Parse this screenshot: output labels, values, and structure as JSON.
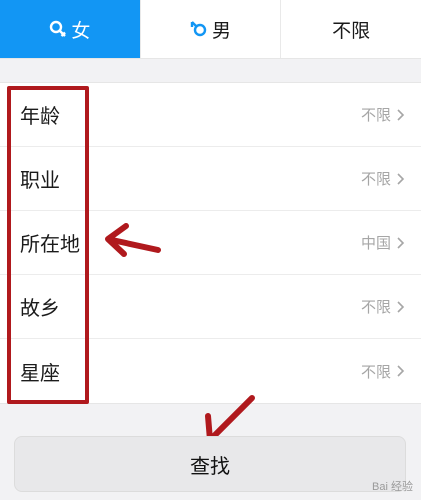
{
  "tabs": [
    {
      "label": "女",
      "icon": "female-icon",
      "active": true
    },
    {
      "label": "男",
      "icon": "male-icon",
      "active": false
    },
    {
      "label": "不限",
      "active": false
    }
  ],
  "rows": [
    {
      "label": "年龄",
      "value": "不限"
    },
    {
      "label": "职业",
      "value": "不限"
    },
    {
      "label": "所在地",
      "value": "中国"
    },
    {
      "label": "故乡",
      "value": "不限"
    },
    {
      "label": "星座",
      "value": "不限"
    }
  ],
  "search_button": {
    "label": "查找"
  },
  "watermark": {
    "text": "Bai 经验"
  },
  "colors": {
    "accent": "#1296f4",
    "annotation": "#b0191d"
  }
}
